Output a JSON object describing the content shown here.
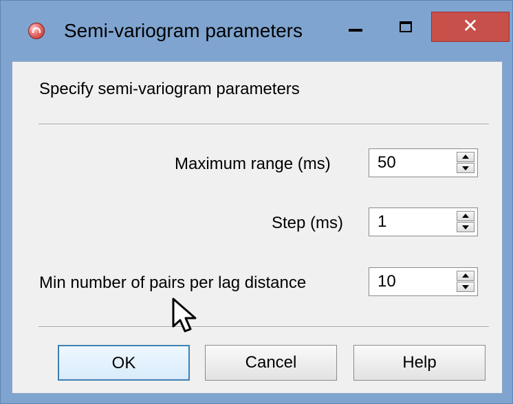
{
  "window": {
    "title": "Semi-variogram parameters",
    "close_glyph": "✕",
    "icons": [
      "app-icon",
      "minimize-icon",
      "maximize-icon",
      "close-icon"
    ]
  },
  "dialog": {
    "heading": "Specify semi-variogram parameters",
    "fields": [
      {
        "label": "Maximum range (ms)",
        "value": "50"
      },
      {
        "label": "Step (ms)",
        "value": "1"
      },
      {
        "label": "Min number of pairs per lag distance",
        "value": "10"
      }
    ],
    "buttons": {
      "ok": "OK",
      "cancel": "Cancel",
      "help": "Help"
    }
  },
  "colors": {
    "titlebar": "#7fa4cf",
    "close_button": "#c8504a",
    "dialog_background": "#f0f0f0",
    "default_button_border": "#3c7fb1"
  }
}
